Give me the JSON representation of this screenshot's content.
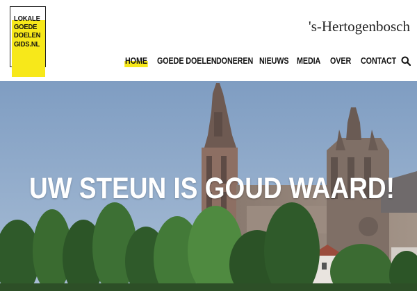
{
  "logo": {
    "lines": [
      "LOKALE",
      "GOEDE",
      "DOELEN",
      "GIDS.NL"
    ],
    "alt": "Lokale Goede Doelen Gids logo"
  },
  "city": "'s-Hertogenbosch",
  "nav": {
    "items": [
      "HOME",
      "GOEDE DOELEN",
      "DONEREN",
      "NIEUWS",
      "MEDIA",
      "OVER",
      "CONTACT"
    ],
    "active": "HOME",
    "search_icon": "search-icon"
  },
  "hero": {
    "title": "UW STEUN IS GOUD WAARD!",
    "image": "cathedral-photo"
  },
  "colors": {
    "accent": "#f7e81a",
    "text": "#111111",
    "sky": "#8fa8c6"
  }
}
